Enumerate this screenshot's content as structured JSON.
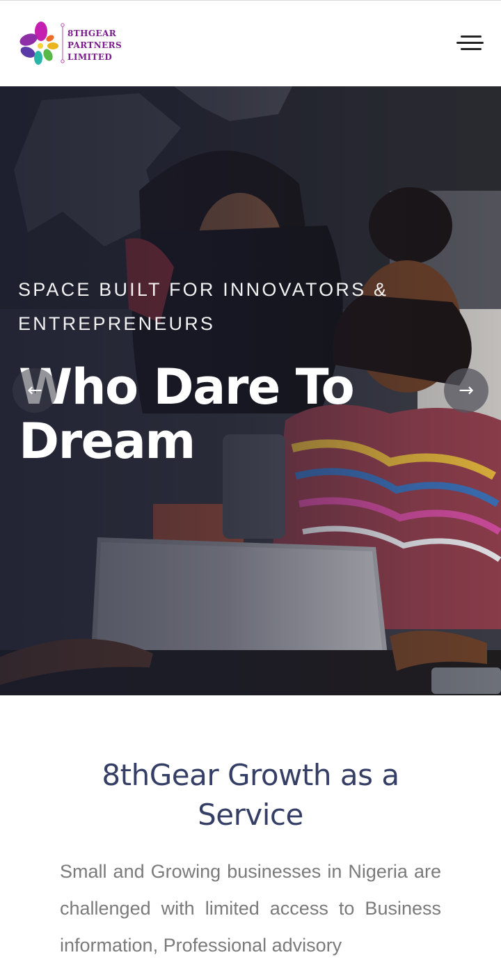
{
  "header": {
    "logo": {
      "line1": "8THGEAR",
      "line2": "PARTNERS",
      "line3": "LIMITED"
    },
    "menu_icon": "hamburger-menu-icon"
  },
  "hero": {
    "eyebrow": "SPACE BUILT FOR INNOVATORS & ENTREPRENEURS",
    "title_line1": "Who Dare To",
    "title_line2": "Dream",
    "prev_icon": "←",
    "next_icon": "→"
  },
  "section": {
    "title_line1": "8thGear Growth as a",
    "title_line2": "Service",
    "body": "Small and Growing businesses in Nigeria are challenged with limited access to Business information, Professional advisory"
  },
  "colors": {
    "logo_text": "#7a1c8c",
    "heading": "#353f66",
    "body_text": "#7a7a7a",
    "hero_overlay": "#1a1c2e"
  }
}
